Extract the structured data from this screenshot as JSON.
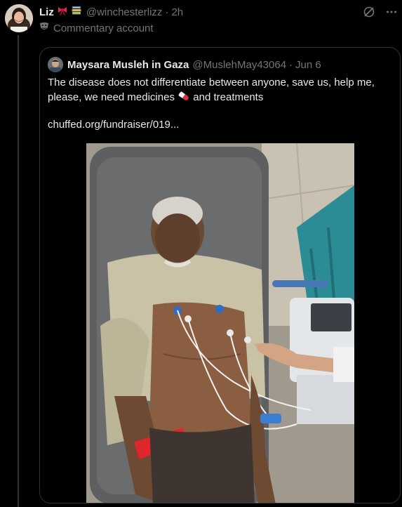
{
  "tweet": {
    "author_name": "Liz",
    "author_emojis": [
      "ribbon-emoji",
      "books-emoji"
    ],
    "handle": "@winchesterlizz",
    "separator": "·",
    "time": "2h",
    "label": "Commentary account",
    "label_icon": "theater-mask-icon"
  },
  "quoted": {
    "author_name": "Maysara Musleh in Gaza",
    "handle": "@MuslehMay43064",
    "separator": "·",
    "time": "Jun 6",
    "text_before_emoji": "The disease does not differentiate between anyone, save us, help me, please, we need medicines ",
    "text_after_emoji": " and treatments",
    "emoji": "pill-emoji",
    "link": "chuffed.org/fundraiser/019..."
  },
  "colors": {
    "background": "#000000",
    "text": "#e7e9ea",
    "muted": "#71767b",
    "border": "#2f3336"
  }
}
